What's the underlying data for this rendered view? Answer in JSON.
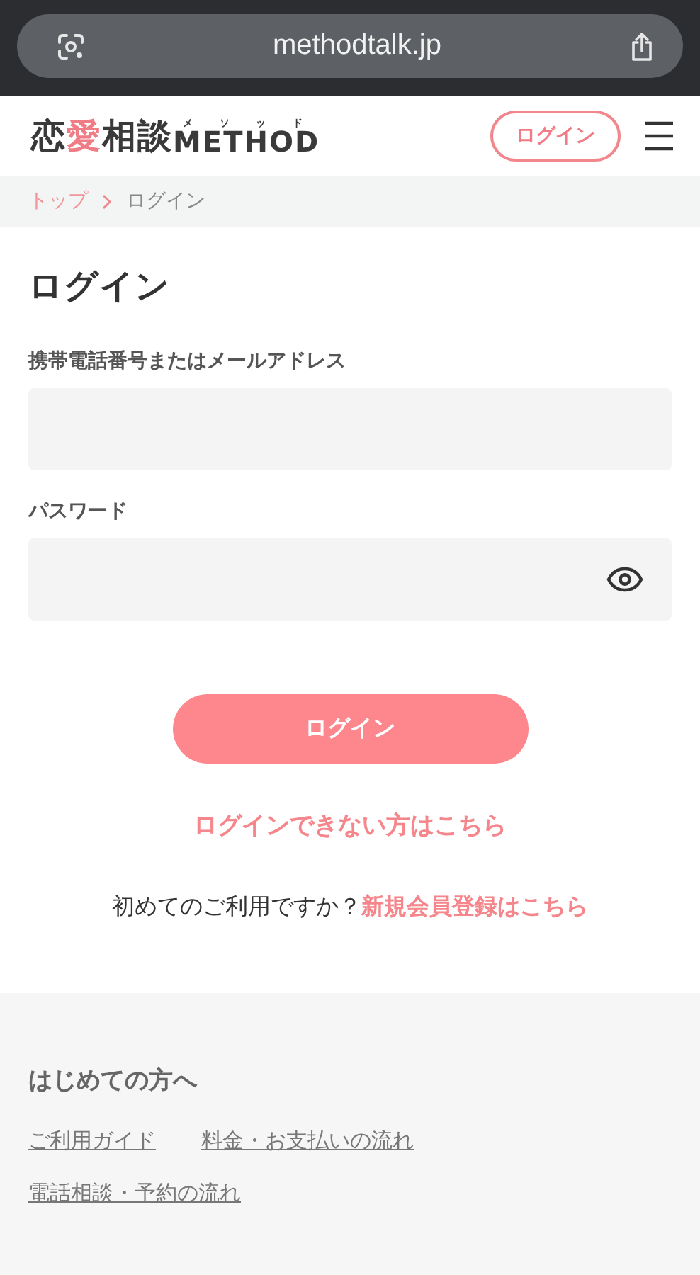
{
  "browser": {
    "url": "methodtalk.jp"
  },
  "header": {
    "logo": {
      "first": "恋",
      "accent": "愛",
      "rest": "相談",
      "brand": "METHOD",
      "ruby": "メソッド"
    },
    "login_button": "ログイン"
  },
  "breadcrumb": [
    {
      "label": "トップ",
      "link": true
    },
    {
      "label": "ログイン",
      "link": false
    }
  ],
  "title": "ログイン",
  "fields": [
    {
      "label": "携帯電話番号またはメールアドレス",
      "kind": "text"
    },
    {
      "label": "パスワード",
      "kind": "password"
    }
  ],
  "submit": "ログイン",
  "forgot_link": "ログインできない方はこちら",
  "signup": {
    "prompt": "初めてのご利用ですか？",
    "link": "新規会員登録はこちら"
  },
  "footer": {
    "heading": "はじめての方へ",
    "links": [
      "ご利用ガイド",
      "料金・お支払いの流れ",
      "電話相談・予約の流れ"
    ]
  }
}
